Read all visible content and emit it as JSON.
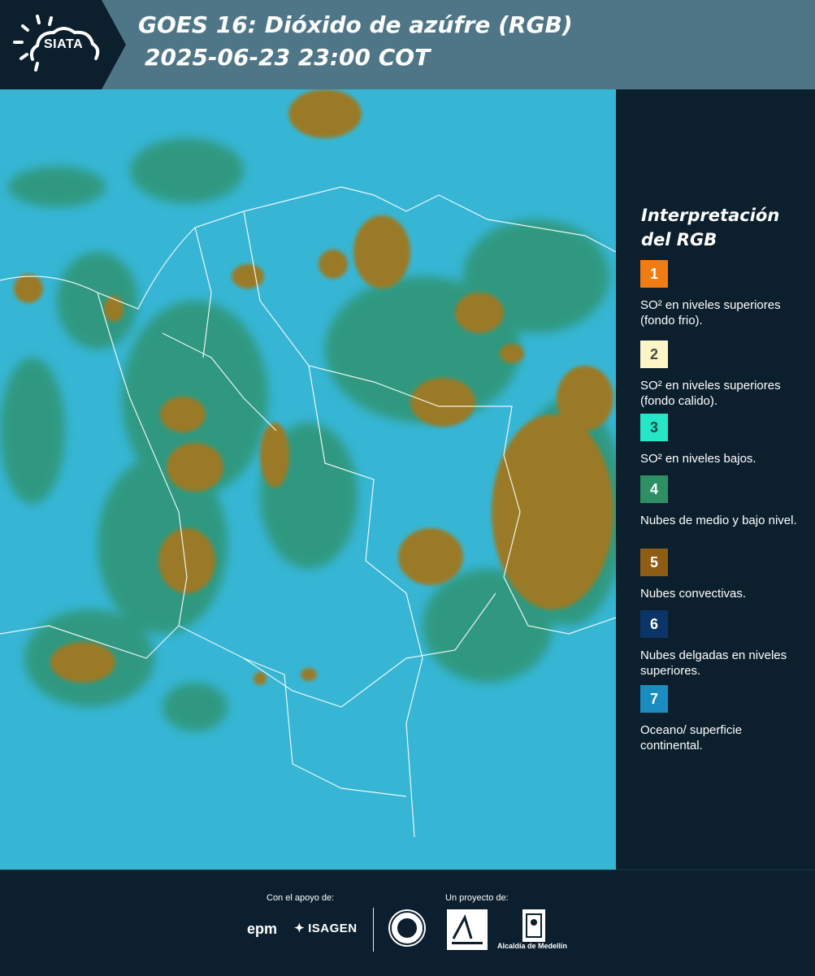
{
  "header": {
    "logo_text": "SIATA",
    "title_line1": "GOES 16: Dióxido de azúfre (RGB)",
    "title_line2": "2025-06-23 23:00 COT"
  },
  "legend": {
    "title": "Interpretación del RGB",
    "items": [
      {
        "number": "1",
        "label": "SO² en niveles superiores (fondo frio).",
        "color": "#f27c14",
        "text_color": "#ffffff"
      },
      {
        "number": "2",
        "label": "SO² en niveles superiores (fondo calido).",
        "color": "#fdf5c6",
        "text_color": "#4a4a4a"
      },
      {
        "number": "3",
        "label": "SO² en niveles bajos.",
        "color": "#26e6c8",
        "text_color": "#1c4a44"
      },
      {
        "number": "4",
        "label": "Nubes de medio y bajo nivel.",
        "color": "#2e8f65",
        "text_color": "#ffffff"
      },
      {
        "number": "5",
        "label": "Nubes convectivas.",
        "color": "#8e5c12",
        "text_color": "#ffffff"
      },
      {
        "number": "6",
        "label": "Nubes delgadas en niveles superiores.",
        "color": "#0b3568",
        "text_color": "#ffffff"
      },
      {
        "number": "7",
        "label": "Oceano/ superficie continental.",
        "color": "#1a8cc0",
        "text_color": "#ffffff"
      }
    ]
  },
  "footer": {
    "support_label": "Con el apoyo de:",
    "project_label": "Un proyecto de:",
    "epm": "epm",
    "isagen": "ISAGEN",
    "alcaldia": "Alcaldía de Medellín"
  },
  "colors": {
    "header_bg": "#4f7687",
    "panel_bg": "#0c1f2d",
    "ocean": "#34b4d2",
    "low_clouds": "#2e8f65",
    "convective": "#9a7a26"
  }
}
